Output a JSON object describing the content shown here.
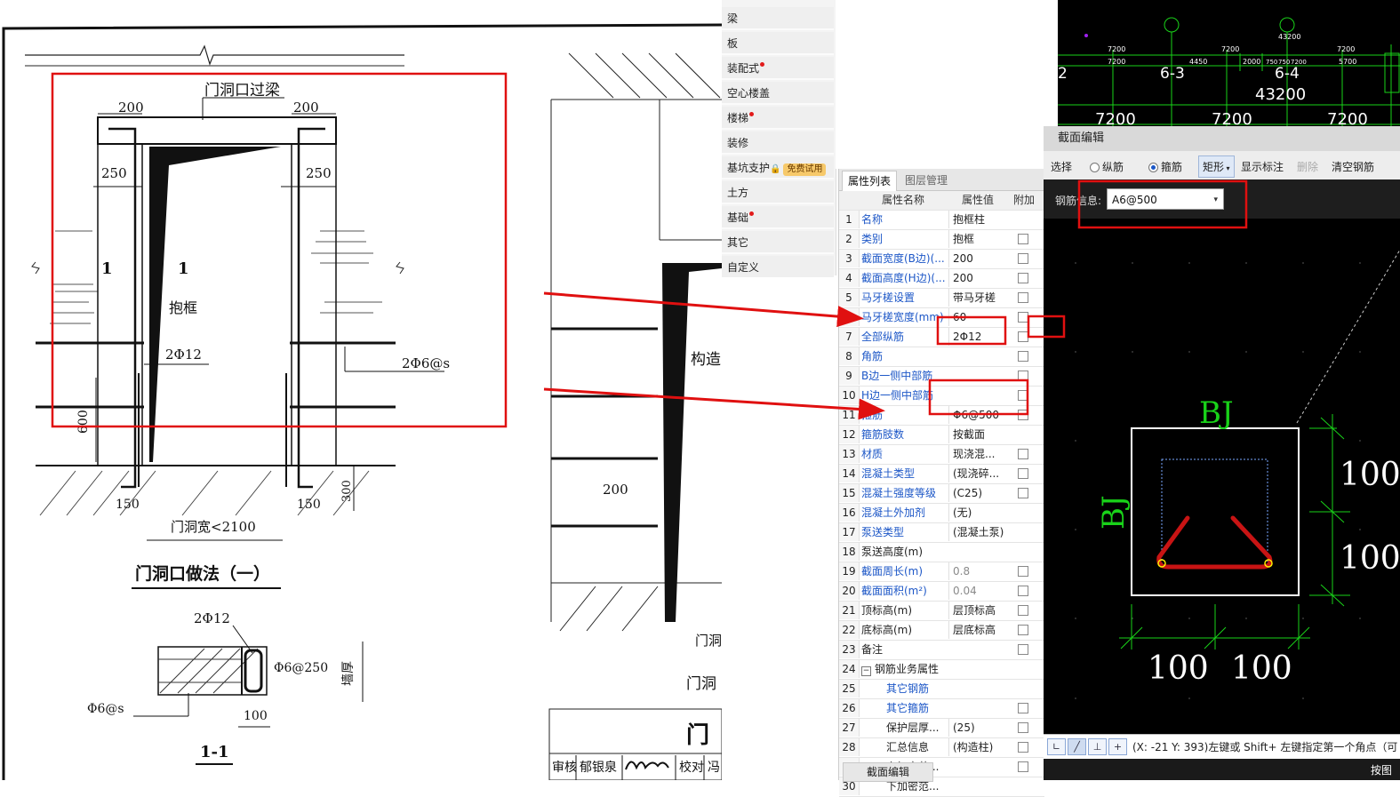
{
  "drawing": {
    "lintel_title": "门洞口过梁",
    "dim_200_left": "200",
    "dim_200_right": "200",
    "dim_250_left": "250",
    "dim_250_right": "250",
    "section_mark": "1",
    "frame_label": "抱框",
    "bar_label_2phi12": "2Φ12",
    "bar_label_2phi6s": "2Φ6@s",
    "dim_600": "600",
    "dim_150_left": "150",
    "dim_150_right": "150",
    "dim_300": "300",
    "door_width": "门洞宽<2100",
    "method_title": "门洞口做法（一）",
    "sec_bar_top": "2Φ12",
    "sec_tie": "Φ6@250",
    "sec_wall": "墙厚",
    "sec_phi6s": "Φ6@s",
    "sec_dim_100": "100",
    "sec_title": "1-1",
    "right_construct": "构造",
    "right_200": "200",
    "right_door1": "门洞",
    "right_door2": "门洞",
    "right_title": "门",
    "signature_row": [
      "审核",
      "郁银泉",
      "",
      "校对",
      "冯"
    ]
  },
  "nav": {
    "items": [
      {
        "label": "梁",
        "dot": false
      },
      {
        "label": "板",
        "dot": false
      },
      {
        "label": "装配式",
        "dot": true
      },
      {
        "label": "空心楼盖",
        "dot": false
      },
      {
        "label": "楼梯",
        "dot": true
      },
      {
        "label": "装修",
        "dot": false
      },
      {
        "label": "基坑支护",
        "dot": false,
        "badge": "免费试用"
      },
      {
        "label": "土方",
        "dot": false
      },
      {
        "label": "基础",
        "dot": true
      },
      {
        "label": "其它",
        "dot": false
      },
      {
        "label": "自定义",
        "dot": false
      }
    ]
  },
  "props": {
    "tabs": [
      "属性列表",
      "图层管理"
    ],
    "headers": [
      "属性名称",
      "属性值",
      "附加"
    ],
    "rows": [
      {
        "no": "1",
        "name": "名称",
        "value": "抱框柱",
        "cb": false,
        "blue": true
      },
      {
        "no": "2",
        "name": "类别",
        "value": "抱框",
        "cb": true,
        "blue": true
      },
      {
        "no": "3",
        "name": "截面宽度(B边)(...",
        "value": "200",
        "cb": true,
        "blue": true
      },
      {
        "no": "4",
        "name": "截面高度(H边)(...",
        "value": "200",
        "cb": true,
        "blue": true
      },
      {
        "no": "5",
        "name": "马牙槎设置",
        "value": "带马牙槎",
        "cb": true,
        "blue": true
      },
      {
        "no": "6",
        "name": "马牙槎宽度(mm)",
        "value": "60",
        "cb": true,
        "blue": true
      },
      {
        "no": "7",
        "name": "全部纵筋",
        "value": "2Φ12",
        "cb": true,
        "blue": true
      },
      {
        "no": "8",
        "name": "角筋",
        "value": "",
        "cb": true,
        "blue": true
      },
      {
        "no": "9",
        "name": "B边一侧中部筋",
        "value": "",
        "cb": true,
        "blue": true
      },
      {
        "no": "10",
        "name": "H边一侧中部筋",
        "value": "",
        "cb": true,
        "blue": true
      },
      {
        "no": "11",
        "name": "箍筋",
        "value": "Φ6@500",
        "cb": true,
        "blue": true
      },
      {
        "no": "12",
        "name": "箍筋肢数",
        "value": "按截面",
        "cb": false,
        "blue": true
      },
      {
        "no": "13",
        "name": "材质",
        "value": "现浇混...",
        "cb": true,
        "blue": true
      },
      {
        "no": "14",
        "name": "混凝土类型",
        "value": "(现浇碎...",
        "cb": true,
        "blue": true
      },
      {
        "no": "15",
        "name": "混凝土强度等级",
        "value": "(C25)",
        "cb": true,
        "blue": true
      },
      {
        "no": "16",
        "name": "混凝土外加剂",
        "value": "(无)",
        "cb": false,
        "blue": true
      },
      {
        "no": "17",
        "name": "泵送类型",
        "value": "(混凝土泵)",
        "cb": false,
        "blue": true
      },
      {
        "no": "18",
        "name": "泵送高度(m)",
        "value": "",
        "cb": false,
        "blue": false
      },
      {
        "no": "19",
        "name": "截面周长(m)",
        "value": "0.8",
        "cb": true,
        "blue": true,
        "gray": true
      },
      {
        "no": "20",
        "name": "截面面积(m²)",
        "value": "0.04",
        "cb": true,
        "blue": true,
        "gray": true
      },
      {
        "no": "21",
        "name": "顶标高(m)",
        "value": "层顶标高",
        "cb": true,
        "blue": false
      },
      {
        "no": "22",
        "name": "底标高(m)",
        "value": "层底标高",
        "cb": true,
        "blue": false
      },
      {
        "no": "23",
        "name": "备注",
        "value": "",
        "cb": true,
        "blue": false
      },
      {
        "no": "24",
        "name": "钢筋业务属性",
        "value": "",
        "cb": false,
        "blue": false,
        "group": true
      },
      {
        "no": "25",
        "name": "其它钢筋",
        "value": "",
        "cb": false,
        "blue": true,
        "indent": true
      },
      {
        "no": "26",
        "name": "其它箍筋",
        "value": "",
        "cb": true,
        "blue": true,
        "indent": true
      },
      {
        "no": "27",
        "name": "保护层厚...",
        "value": "(25)",
        "cb": true,
        "blue": false,
        "indent": true
      },
      {
        "no": "28",
        "name": "汇总信息",
        "value": "(构造柱)",
        "cb": true,
        "blue": false,
        "indent": true
      },
      {
        "no": "29",
        "name": "上加密范...",
        "value": "",
        "cb": true,
        "blue": false,
        "indent": true
      },
      {
        "no": "30",
        "name": "下加密范...",
        "value": "",
        "cb": false,
        "blue": false,
        "indent": true
      }
    ],
    "footer_btn": "截面编辑"
  },
  "cadtop": {
    "axis_a": "6-3",
    "axis_b": "6-4",
    "total": "43200",
    "small_total": "43200",
    "spans_small": [
      "7200",
      "7200",
      "7200",
      "7200",
      "4450",
      "2000",
      "750",
      "750",
      "7200",
      "5700"
    ],
    "spans_big": [
      "7200",
      "7200",
      "7200"
    ],
    "left_num": "2"
  },
  "section_editor": {
    "title": "截面编辑",
    "tool_select": "选择",
    "radio_long": "纵筋",
    "radio_stirrup": "箍筋",
    "shape": "矩形",
    "show_label": "显示标注",
    "delete": "删除",
    "clear": "清空钢筋",
    "rebar_label": "钢筋信息:",
    "rebar_value": "A6@500",
    "bj_top": "BJ",
    "bj_left": "BJ",
    "dim_r1": "100",
    "dim_r2": "100",
    "dim_b1": "100",
    "dim_b2": "100",
    "status_text": "(X: -21 Y: 393)左键或 Shift+ 左键指定第一个角点（可",
    "bottom_right": "按图"
  },
  "colors": {
    "annotation_red": "#e01010",
    "cad_green": "#19d219",
    "rebar_red": "#c81414",
    "link_blue": "#1d57c7"
  }
}
